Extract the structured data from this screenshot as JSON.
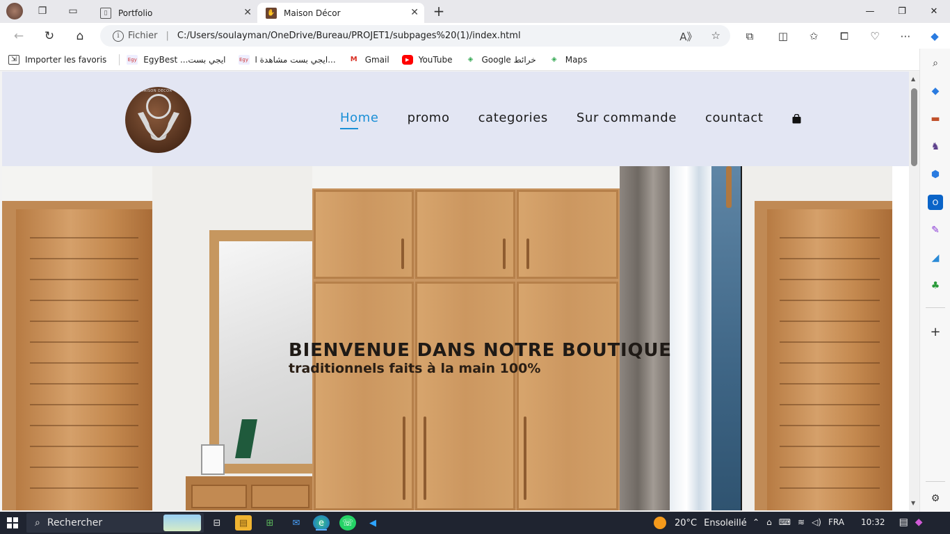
{
  "browser": {
    "tabs": [
      {
        "title": "Portfolio",
        "active": false
      },
      {
        "title": "Maison Décor",
        "active": true
      }
    ],
    "address": {
      "scheme_label": "Fichier",
      "url": "C:/Users/soulayman/OneDrive/Bureau/PROJET1/subpages%20(1)/index.html"
    },
    "bookmarks": [
      {
        "label": "Importer les favoris",
        "icon": "import-icon"
      },
      {
        "label": "EgyBest ...ايجي بست",
        "icon": "egybest-icon"
      },
      {
        "label": "ايجي بست مشاهدة ا...",
        "icon": "egybest-icon"
      },
      {
        "label": "Gmail",
        "icon": "gmail-icon"
      },
      {
        "label": "YouTube",
        "icon": "youtube-icon"
      },
      {
        "label": "Google خرائط",
        "icon": "maps-icon"
      },
      {
        "label": "Maps",
        "icon": "maps-icon"
      }
    ]
  },
  "site": {
    "logo_text": "MAISON DECOR",
    "nav": [
      "Home",
      "promo",
      "categories",
      "Sur commande",
      "countact"
    ],
    "active_nav": "Home",
    "hero": {
      "title": "BIENVENUE DANS NOTRE BOUTIQUE",
      "subtitle": "traditionnels faits à la main 100%"
    }
  },
  "taskbar": {
    "search_placeholder": "Rechercher",
    "weather": {
      "temp": "20°C",
      "condition": "Ensoleillé"
    },
    "language": "FRA",
    "time": "10:32"
  },
  "colors": {
    "header_bg": "#e3e6f3",
    "nav_active": "#1a8fd6",
    "taskbar_bg": "#1f2430"
  }
}
